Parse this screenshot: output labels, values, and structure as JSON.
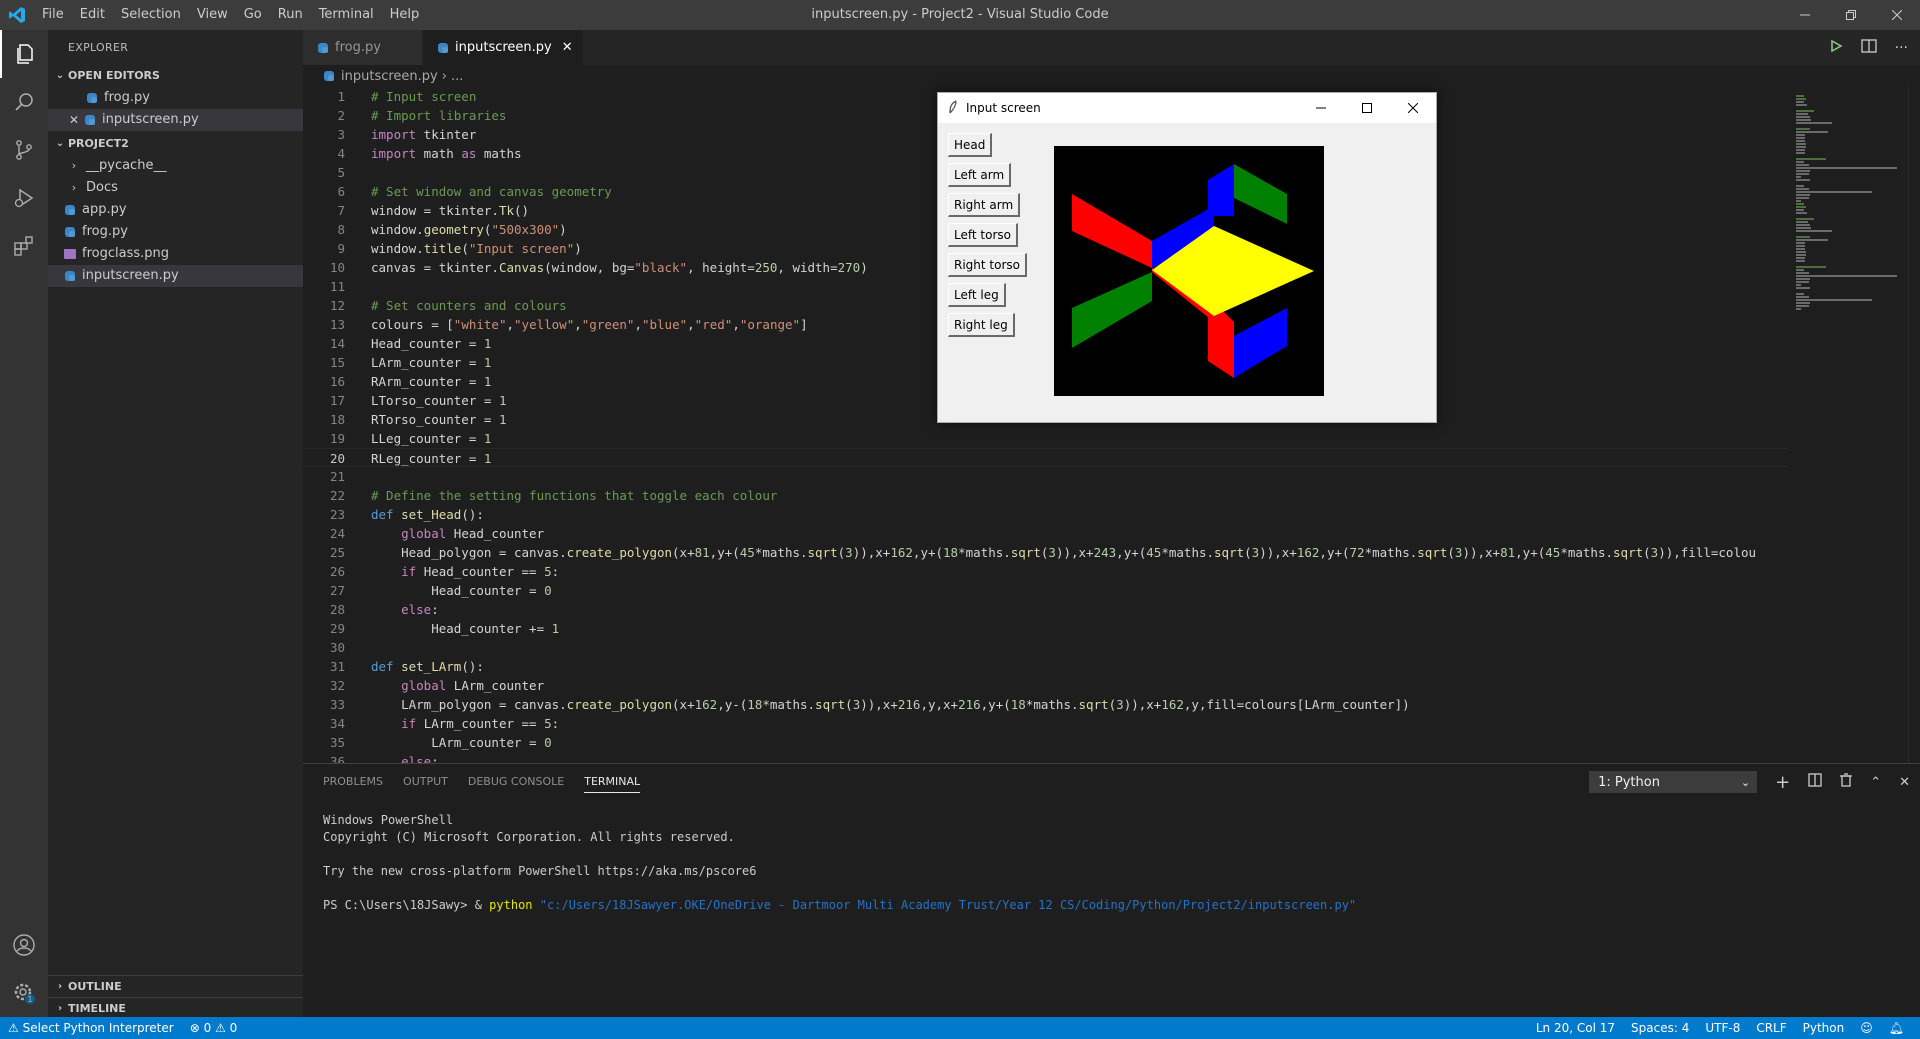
{
  "window": {
    "title": "inputscreen.py - Project2 - Visual Studio Code",
    "menu": [
      "File",
      "Edit",
      "Selection",
      "View",
      "Go",
      "Run",
      "Terminal",
      "Help"
    ]
  },
  "sidebar": {
    "title": "EXPLORER",
    "open_editors_label": "OPEN EDITORS",
    "open_editors": [
      "frog.py",
      "inputscreen.py"
    ],
    "project_label": "PROJECT2",
    "folders": [
      "__pycache__",
      "Docs"
    ],
    "files": [
      "app.py",
      "frog.py",
      "frogclass.png",
      "inputscreen.py"
    ],
    "outline_label": "OUTLINE",
    "timeline_label": "TIMELINE"
  },
  "tabs": [
    {
      "label": "frog.py",
      "active": false
    },
    {
      "label": "inputscreen.py",
      "active": true
    }
  ],
  "breadcrumb": {
    "file": "inputscreen.py",
    "more": "..."
  },
  "editor": {
    "current_line": 20,
    "lines": [
      "# Input screen",
      "# Import libraries",
      "import tkinter",
      "import math as maths",
      "",
      "# Set window and canvas geometry",
      "window = tkinter.Tk()",
      "window.geometry(\"500x300\")",
      "window.title(\"Input screen\")",
      "canvas = tkinter.Canvas(window, bg=\"black\", height=250, width=270)",
      "",
      "# Set counters and colours",
      "colours = [\"white\",\"yellow\",\"green\",\"blue\",\"red\",\"orange\"]",
      "Head_counter = 1",
      "LArm_counter = 1",
      "RArm_counter = 1",
      "LTorso_counter = 1",
      "RTorso_counter = 1",
      "LLeg_counter = 1",
      "RLeg_counter = 1",
      "",
      "# Define the setting functions that toggle each colour",
      "def set_Head():",
      "    global Head_counter",
      "    Head_polygon = canvas.create_polygon(x+81,y+(45*maths.sqrt(3)),x+162,y+(18*maths.sqrt(3)),x+243,y+(45*maths.sqrt(3)),x+162,y+(72*maths.sqrt(3)),x+81,y+(45*maths.sqrt(3)),fill=colou",
      "    if Head_counter == 5:",
      "        Head_counter = 0",
      "    else:",
      "        Head_counter += 1",
      "",
      "def set_LArm():",
      "    global LArm_counter",
      "    LArm_polygon = canvas.create_polygon(x+162,y-(18*maths.sqrt(3)),x+216,y,x+216,y+(18*maths.sqrt(3)),x+162,y,fill=colours[LArm_counter])",
      "    if LArm_counter == 5:",
      "        LArm_counter = 0",
      "    else:"
    ]
  },
  "tk_window": {
    "title": "Input screen",
    "buttons": [
      "Head",
      "Left arm",
      "Right arm",
      "Left torso",
      "Right torso",
      "Left leg",
      "Right leg"
    ],
    "canvas_bg": "black",
    "colors": {
      "red": "#ff0000",
      "blue": "#0000ff",
      "green": "#008000",
      "yellow": "#ffff00"
    }
  },
  "panel": {
    "tabs": [
      "PROBLEMS",
      "OUTPUT",
      "DEBUG CONSOLE",
      "TERMINAL"
    ],
    "active_tab": "TERMINAL",
    "terminal_select": "1: Python",
    "terminal_lines": [
      "Windows PowerShell",
      "Copyright (C) Microsoft Corporation. All rights reserved.",
      "",
      "Try the new cross-platform PowerShell https://aka.ms/pscore6",
      ""
    ],
    "prompt": "PS C:\\Users\\18JSawy> & ",
    "prompt_cmd": "python",
    "prompt_arg": "\"c:/Users/18JSawyer.OKE/OneDrive - Dartmoor Multi Academy Trust/Year 12 CS/Coding/Python/Project2/inputscreen.py\""
  },
  "statusbar": {
    "interpreter": "Select Python Interpreter",
    "errors": "0",
    "warnings": "0",
    "position": "Ln 20, Col 17",
    "spaces": "Spaces: 4",
    "encoding": "UTF-8",
    "eol": "CRLF",
    "language": "Python",
    "accent": "#007acc"
  }
}
